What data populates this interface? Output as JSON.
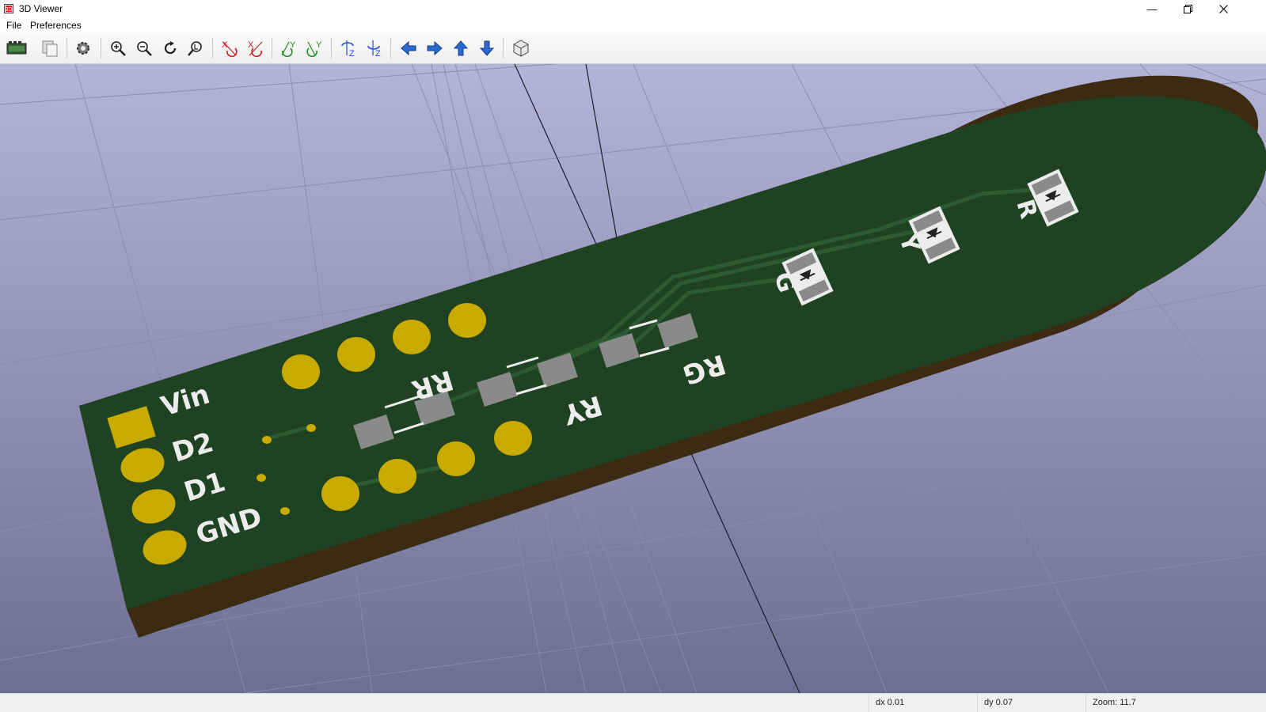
{
  "window": {
    "title": "3D Viewer"
  },
  "menu": [
    {
      "label": "File"
    },
    {
      "label": "Preferences"
    }
  ],
  "toolbar": [
    "render-raytracing-icon",
    "copy-to-clipboard-icon",
    "display-options-icon",
    "zoom-in-icon",
    "zoom-out-icon",
    "redraw-icon",
    "zoom-auto-icon",
    "rotate-x-cw-icon",
    "rotate-x-ccw-icon",
    "rotate-y-cw-icon",
    "rotate-y-ccw-icon",
    "rotate-z-cw-icon",
    "rotate-z-ccw-icon",
    "move-left-icon",
    "move-right-icon",
    "move-up-icon",
    "move-down-icon",
    "ortho-view-icon"
  ],
  "board": {
    "labels": {
      "vin": "Vin",
      "d2": "D2",
      "d1": "D1",
      "gnd": "GND",
      "rr": "RR",
      "ry": "RY",
      "rg": "RG",
      "g": "G",
      "y": "Y",
      "r": "R"
    },
    "colors": {
      "background_top": "#b4b4d8",
      "background_bottom": "#6e6e92",
      "mask": "#1f4222",
      "pad": "#c9ab00",
      "silk": "#ececec",
      "edge": "#3a2b12"
    }
  },
  "status": {
    "dx": "dx 0.01",
    "dy": "dy 0.07",
    "zoom": "Zoom: 11.7"
  }
}
